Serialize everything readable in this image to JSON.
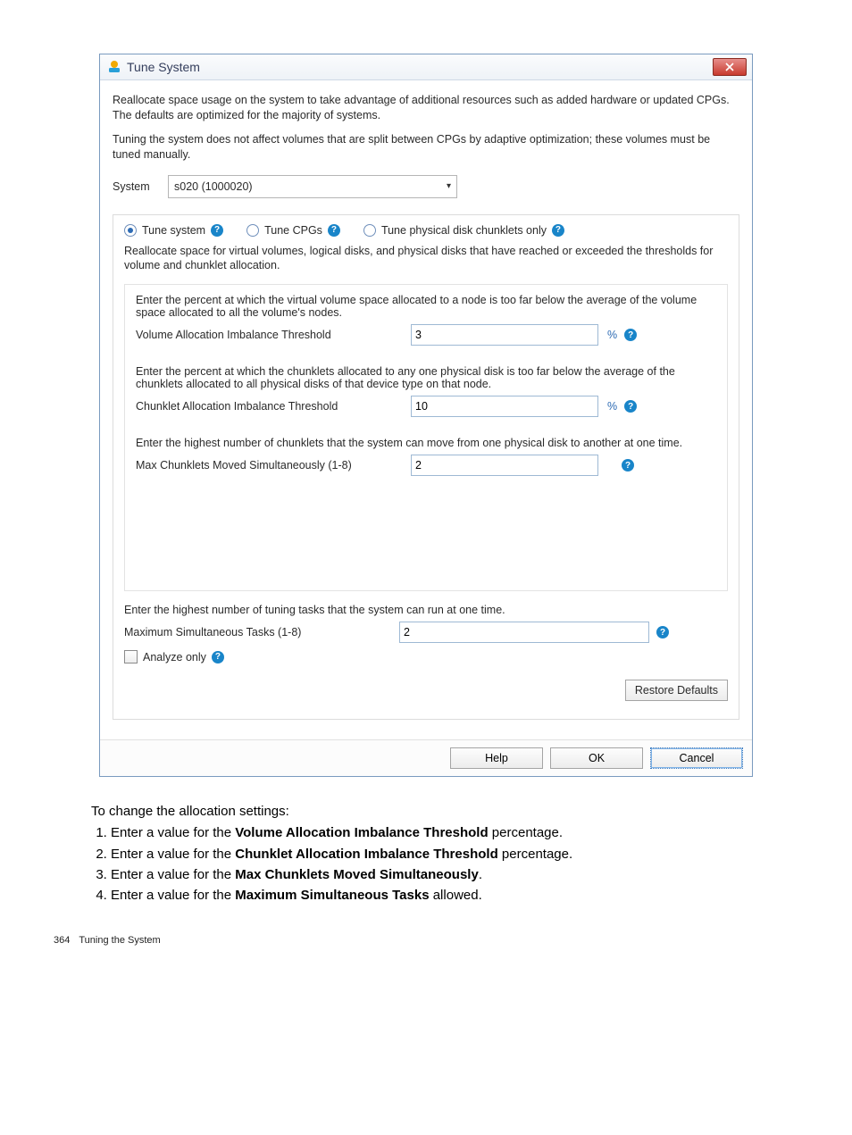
{
  "titlebar": {
    "title": "Tune System"
  },
  "intro": {
    "p1": "Reallocate space usage on the system to take advantage of additional resources such as added hardware or updated CPGs. The defaults are optimized for the majority of systems.",
    "p2": "Tuning the system does not affect volumes that are split between CPGs by adaptive optimization; these volumes must be tuned manually."
  },
  "system": {
    "label": "System",
    "value": "s020 (1000020)"
  },
  "radios": {
    "tune_system": "Tune system",
    "tune_cpgs": "Tune CPGs",
    "tune_chunklets": "Tune physical disk chunklets only"
  },
  "panel": {
    "desc": "Reallocate space for virtual volumes, logical disks, and physical disks that have reached or exceeded the thresholds for volume and chunklet allocation.",
    "vol_desc": "Enter the percent at which the virtual volume space allocated to a node is too far below the average of the volume space allocated to all the volume's nodes.",
    "vol_label": "Volume Allocation Imbalance Threshold",
    "vol_value": "3",
    "chunk_desc": "Enter the percent at which the chunklets allocated to any one physical disk is too far below the average of the chunklets allocated to all physical disks of that device type on that node.",
    "chunk_label": "Chunklet Allocation Imbalance Threshold",
    "chunk_value": "10",
    "max_desc": "Enter the highest number of chunklets that the system can move from one physical disk to another at one time.",
    "max_label": "Max Chunklets Moved Simultaneously  (1-8)",
    "max_value": "2",
    "pct": "%"
  },
  "tasks": {
    "desc": "Enter the highest number of tuning tasks that the system can run at one time.",
    "label": "Maximum Simultaneous Tasks  (1-8)",
    "value": "2"
  },
  "analyze": {
    "label": "Analyze only"
  },
  "buttons": {
    "restore": "Restore Defaults",
    "help": "Help",
    "ok": "OK",
    "cancel": "Cancel"
  },
  "doc": {
    "lead": "To change the allocation settings:",
    "items": {
      "1_before": "Enter a value for the ",
      "1_bold": "Volume Allocation Imbalance Threshold",
      "1_after": " percentage.",
      "2_before": "Enter a value for the ",
      "2_bold": "Chunklet Allocation Imbalance Threshold",
      "2_after": " percentage.",
      "3_before": "Enter a value for the ",
      "3_bold": "Max Chunklets Moved Simultaneously",
      "3_after": ".",
      "4_before": "Enter a value for the ",
      "4_bold": "Maximum Simultaneous Tasks",
      "4_after": " allowed."
    }
  },
  "footer": {
    "page": "364",
    "section": "Tuning the System"
  }
}
